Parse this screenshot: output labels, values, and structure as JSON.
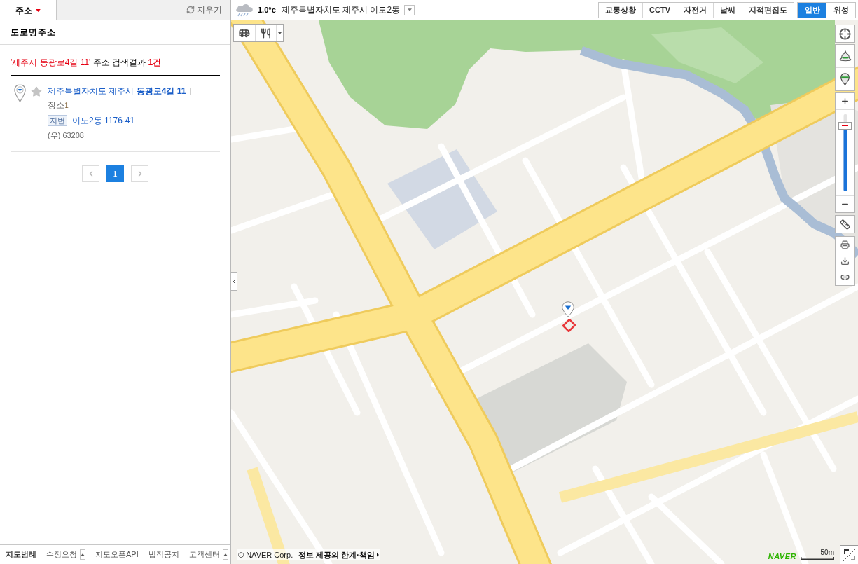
{
  "sidebar": {
    "tabs": [
      {
        "label": "주소",
        "selected": true
      }
    ],
    "clear_button": "지우기",
    "section_title": "도로명주소",
    "summary": {
      "query": "'제주시 동광로4길 11'",
      "text": "주소 검색결과",
      "count": "1건"
    },
    "results": [
      {
        "address": "제주특별자치도 제주시 **동광로4길 11**",
        "starred": false,
        "place_label": "장소",
        "place_count": "1",
        "lot_tag": "지번",
        "lot_address": "이도2동 1176-41",
        "postal_code": "(우) 63208"
      }
    ],
    "pages": [
      {
        "label": "1",
        "selected": true
      }
    ],
    "footer_links": [
      {
        "label": "지도범례",
        "kind": "link",
        "emphasized": true
      },
      {
        "label": "수정요청",
        "kind": "menu",
        "emphasized": false
      },
      {
        "label": "지도오픈API",
        "kind": "link",
        "emphasized": false
      },
      {
        "label": "법적공지",
        "kind": "link",
        "emphasized": false
      },
      {
        "label": "고객센터",
        "kind": "menu",
        "emphasized": false
      }
    ]
  },
  "top_bar": {
    "temperature": "1.0°c",
    "location": "제주특별자치도 제주시 이도2동",
    "layers": [
      {
        "label": "교통상황",
        "selected": false
      },
      {
        "label": "CCTV",
        "selected": false
      },
      {
        "label": "자전거",
        "selected": false
      },
      {
        "label": "날씨",
        "selected": false
      },
      {
        "label": "지적편집도",
        "selected": false
      }
    ],
    "map_types": [
      {
        "label": "일반",
        "selected": true
      },
      {
        "label": "위성",
        "selected": false
      }
    ]
  },
  "map": {
    "zoom": {
      "level": 0.85
    },
    "copyright": "© NAVER Corp.",
    "disclaimer_link": "정보 제공의 한계·책임",
    "logo": "NAVER",
    "scale": "50m"
  }
}
